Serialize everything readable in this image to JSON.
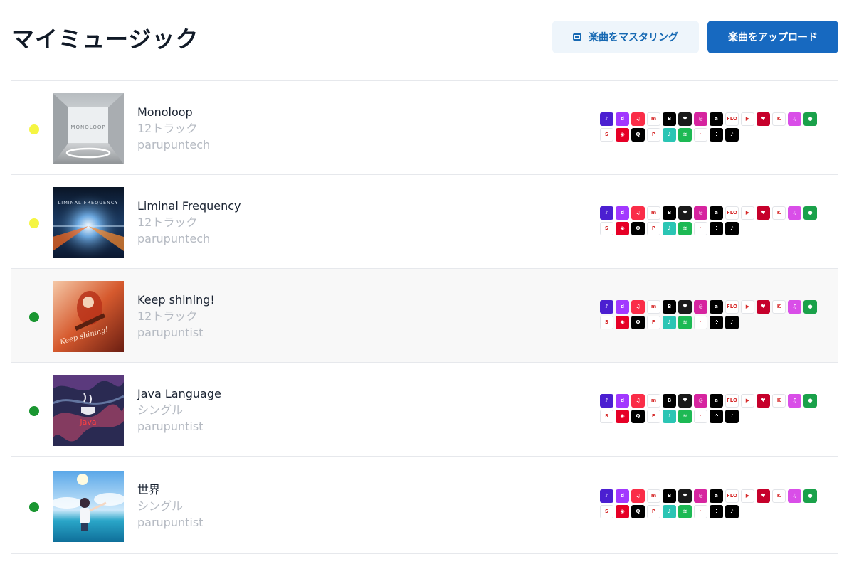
{
  "page": {
    "title": "マイミュージック"
  },
  "actions": {
    "master_label": "楽曲をマスタリング",
    "upload_label": "楽曲をアップロード"
  },
  "status_colors": {
    "pending": "#f5f542",
    "live": "#1a9631"
  },
  "releases": [
    {
      "name": "Monoloop",
      "tracks": "12トラック",
      "artist": "parupuntech",
      "status": "pending",
      "art_text": "MONOLOOP",
      "art_icon": "monoloop-cover-art"
    },
    {
      "name": "Liminal Frequency",
      "tracks": "12トラック",
      "artist": "parupuntech",
      "status": "pending",
      "art_text": "LIMINAL FREQUENCY",
      "art_icon": "liminal-cover-art"
    },
    {
      "name": "Keep shining!",
      "tracks": "12トラック",
      "artist": "parupuntist",
      "status": "live",
      "art_text": "Keep shining!",
      "art_icon": "keep-shining-cover-art"
    },
    {
      "name": "Java Language",
      "tracks": "シングル",
      "artist": "parupuntist",
      "status": "live",
      "art_text": "Java",
      "art_icon": "java-cover-art"
    },
    {
      "name": "世界",
      "tracks": "シングル",
      "artist": "parupuntist",
      "status": "live",
      "art_text": "",
      "art_icon": "sekai-cover-art"
    }
  ],
  "platforms_row1": [
    {
      "name": "amazon-music-icon",
      "color": "#4b1fd1",
      "glyph": "♪"
    },
    {
      "name": "deezer-icon",
      "color": "#a238ff",
      "glyph": "d"
    },
    {
      "name": "apple-music-icon",
      "color": "#fa2d48",
      "glyph": "♫"
    },
    {
      "name": "melon-icon",
      "color": "#ffffff",
      "glyph": "m"
    },
    {
      "name": "boomplay-icon",
      "color": "#000000",
      "glyph": "B"
    },
    {
      "name": "heart-app-icon",
      "color": "#1a1a1a",
      "glyph": "♥"
    },
    {
      "name": "instagram-icon",
      "color": "#d6249f",
      "glyph": "◎"
    },
    {
      "name": "anghami-icon",
      "color": "#000000",
      "glyph": "a"
    },
    {
      "name": "flo-icon",
      "color": "#ffffff",
      "glyph": "FLO"
    },
    {
      "name": "youtube-music-icon",
      "color": "#ffffff",
      "glyph": "▶"
    },
    {
      "name": "iheartradio-icon",
      "color": "#c6002b",
      "glyph": "♥"
    },
    {
      "name": "kkbox-icon",
      "color": "#ffffff",
      "glyph": "K"
    },
    {
      "name": "itunes-icon",
      "color": "#d94ee8",
      "glyph": "♫"
    },
    {
      "name": "audiomack-icon",
      "color": "#1aa14a",
      "glyph": "●"
    }
  ],
  "platforms_row2": [
    {
      "name": "shazam-icon",
      "color": "#ffffff",
      "glyph": "S"
    },
    {
      "name": "netease-icon",
      "color": "#e60026",
      "glyph": "◉"
    },
    {
      "name": "qobuz-icon",
      "color": "#000000",
      "glyph": "Q"
    },
    {
      "name": "pandora-icon",
      "color": "#ffffff",
      "glyph": "P"
    },
    {
      "name": "jiosaavn-icon",
      "color": "#2bc5b4",
      "glyph": "♪"
    },
    {
      "name": "spotify-icon",
      "color": "#1db954",
      "glyph": "≋"
    },
    {
      "name": "tidal-icon",
      "color": "#ffffff",
      "glyph": "ᐧ"
    },
    {
      "name": "soundcloud-dots-icon",
      "color": "#000000",
      "glyph": "⁘"
    },
    {
      "name": "tiktok-icon",
      "color": "#000000",
      "glyph": "♪"
    }
  ]
}
